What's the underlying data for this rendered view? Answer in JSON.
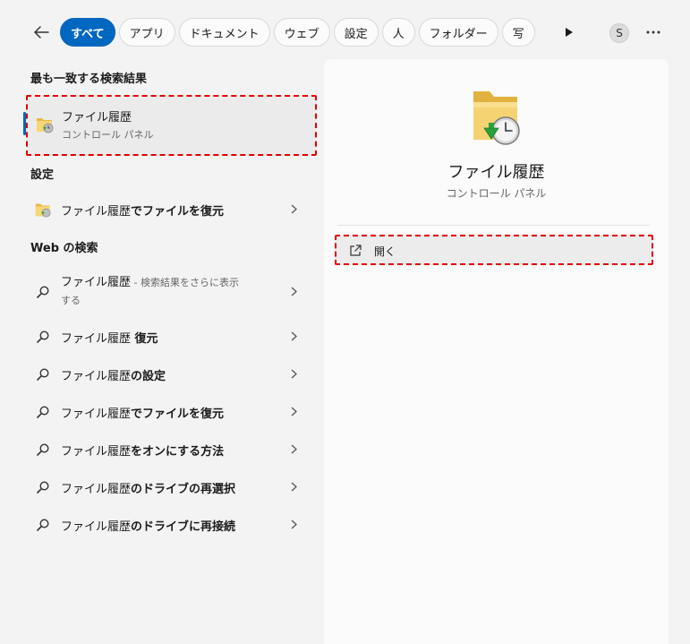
{
  "tabs": [
    "すべて",
    "アプリ",
    "ドキュメント",
    "ウェブ",
    "設定",
    "人",
    "フォルダー",
    "写"
  ],
  "avatar_initial": "S",
  "left": {
    "best_match_title": "最も一致する検索結果",
    "best_match": {
      "title": "ファイル履歴",
      "subtitle": "コントロール パネル"
    },
    "settings_title": "設定",
    "settings_item": {
      "prefix": "ファイル履歴",
      "bold": "でファイルを復元"
    },
    "web_title": "Web の検索",
    "web_first": {
      "prefix": "ファイル履歴",
      "sub1": " - 検索結果をさらに表示",
      "sub2": "する"
    },
    "web_items": [
      {
        "prefix": "ファイル履歴",
        "bold": " 復元"
      },
      {
        "prefix": "ファイル履歴",
        "bold": "の設定"
      },
      {
        "prefix": "ファイル履歴",
        "bold": "でファイルを復元"
      },
      {
        "prefix": "ファイル履歴",
        "bold": "をオンにする方法"
      },
      {
        "prefix": "ファイル履歴",
        "bold": "のドライブの再選択"
      },
      {
        "prefix": "ファイル履歴",
        "bold": "のドライブに再接続"
      }
    ]
  },
  "right": {
    "app_name": "ファイル履歴",
    "app_subtitle": "コントロール パネル",
    "open_label": "開く"
  },
  "colors": {
    "accent": "#0067c0",
    "highlight_border": "#e00000"
  }
}
